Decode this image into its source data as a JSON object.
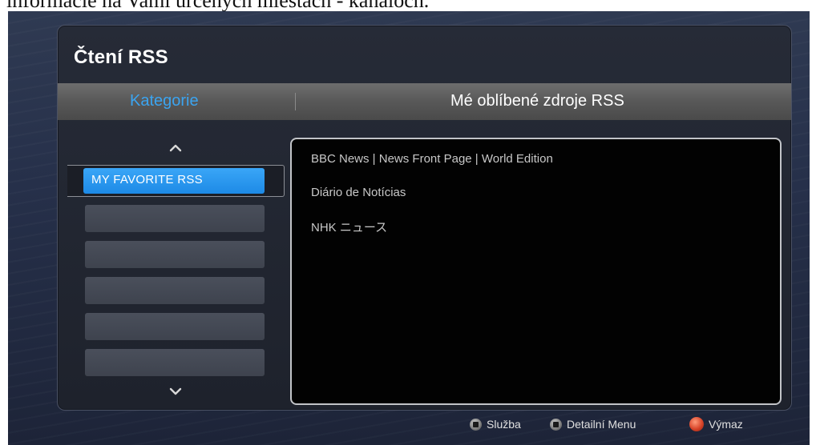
{
  "caption": "informacie na Vami urcenych miestach - kanaloch.",
  "app": {
    "title": "Čtení RSS"
  },
  "header": {
    "left_label": "Kategorie",
    "right_label": "Mé oblíbené zdroje RSS"
  },
  "categories": {
    "items": [
      {
        "label": "MY FAVORITE RSS",
        "selected": true
      },
      {
        "label": "",
        "selected": false
      },
      {
        "label": "",
        "selected": false
      },
      {
        "label": "",
        "selected": false
      },
      {
        "label": "",
        "selected": false
      },
      {
        "label": "",
        "selected": false
      }
    ],
    "scroll_up_icon": "chevron-up-icon",
    "scroll_down_icon": "chevron-down-icon"
  },
  "feeds": {
    "items": [
      {
        "label": "BBC News | News Front Page | World Edition"
      },
      {
        "label": "Diário de Notícias"
      },
      {
        "label": "NHK ニュース"
      }
    ]
  },
  "footer": {
    "service_label": "Služba",
    "detail_menu_label": "Detailní Menu",
    "delete_label": "Výmaz",
    "service_icon": "grey-button-icon",
    "detail_menu_icon": "grey-button-icon",
    "delete_icon": "red-button-icon"
  },
  "colors": {
    "accent": "#3ba4f0",
    "selected_item": "#2a96f0",
    "delete_button": "#d8452a"
  }
}
